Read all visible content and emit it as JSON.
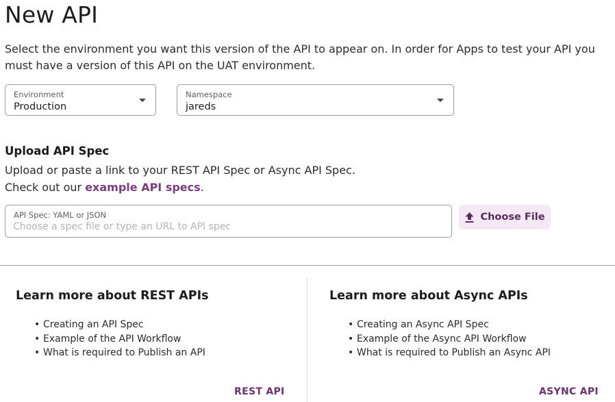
{
  "page": {
    "title": "New API",
    "intro": "Select the environment you want this version of the API to appear on. In order for Apps to test your API you must have a version of this API on the UAT environment."
  },
  "environment": {
    "label": "Environment",
    "value": "Production"
  },
  "namespace": {
    "label": "Namespace",
    "value": "jareds"
  },
  "upload": {
    "heading": "Upload API Spec",
    "line1": "Upload or paste a link to your REST API Spec or Async API Spec.",
    "line2_prefix": "Check out our ",
    "link_text": "example API specs",
    "line2_suffix": ".",
    "field_label": "API Spec: YAML or JSON",
    "placeholder": "Choose a spec file or type an URL to API spec",
    "choose_label": "Choose File"
  },
  "rest": {
    "heading": "Learn more about REST APIs",
    "items": [
      "Creating an API Spec",
      "Example of the API Workflow",
      "What is required to Publish an API"
    ],
    "link": "REST API"
  },
  "async": {
    "heading": "Learn more about Async APIs",
    "items": [
      "Creating an Async API Spec",
      "Example of the Async API Workflow",
      "What is required to Publish an Async API"
    ],
    "link": "ASYNC API"
  },
  "icons": {
    "dropdown": "caret-down-icon",
    "upload": "upload-icon"
  },
  "colors": {
    "accent": "#7b3d7f",
    "button_bg": "#f3e8f3"
  }
}
